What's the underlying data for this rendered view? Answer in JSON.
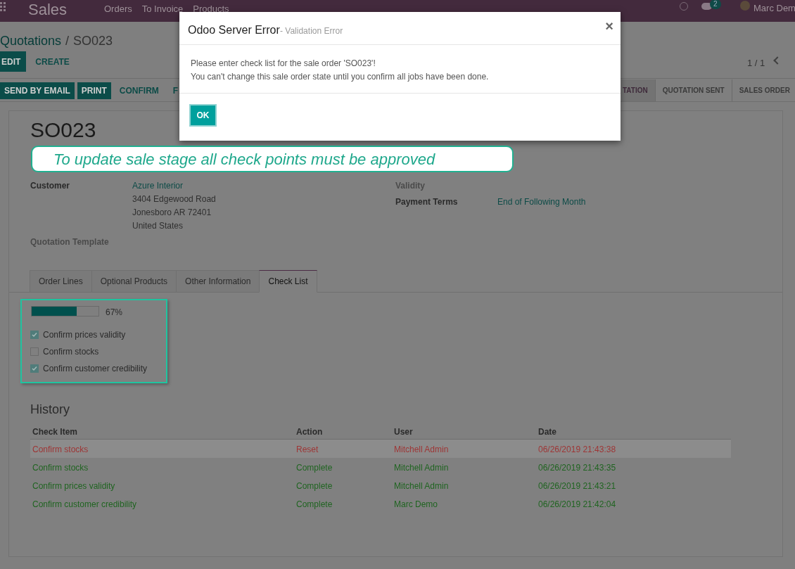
{
  "top_bar": {
    "app": "Sales",
    "menu": [
      "Orders",
      "To Invoice",
      "Products"
    ],
    "message_count": "2",
    "user": "Marc Dem"
  },
  "breadcrumb": {
    "parent": "Quotations",
    "separator": "/",
    "current": "SO023"
  },
  "actions": [
    "EDIT",
    "CREATE"
  ],
  "pager": "1 / 1",
  "header_buttons": [
    {
      "label": "SEND BY EMAIL",
      "primary": true
    },
    {
      "label": "PRINT",
      "primary": true
    },
    {
      "label": "CONFIRM",
      "primary": false
    },
    {
      "label": "F",
      "primary": false
    }
  ],
  "stages": [
    {
      "label": "TATION",
      "selected": true
    },
    {
      "label": "QUOTATION SENT",
      "selected": false
    },
    {
      "label": "SALES ORDER",
      "selected": false
    }
  ],
  "form": {
    "title": "SO023",
    "left_fields": [
      {
        "label": "Customer",
        "link": "Azure Interior",
        "lines": [
          "3404 Edgewood Road",
          "Jonesboro AR 72401",
          "United States"
        ]
      },
      {
        "label": "Quotation Template"
      }
    ],
    "right_fields": [
      {
        "label": "Validity"
      },
      {
        "label": "Payment Terms",
        "link": "End of Following Month"
      }
    ]
  },
  "tabs": [
    {
      "label": "Order Lines",
      "selected": false
    },
    {
      "label": "Optional Products",
      "selected": false
    },
    {
      "label": "Other Information",
      "selected": false
    },
    {
      "label": "Check List",
      "selected": true
    }
  ],
  "checklist": {
    "level": 0.67,
    "reading": "67%",
    "items": [
      {
        "label": "Confirm prices validity",
        "checked": true
      },
      {
        "label": "Confirm stocks",
        "checked": false
      },
      {
        "label": "Confirm customer credibility",
        "checked": true
      }
    ]
  },
  "history": {
    "title": "History",
    "columns": [
      "Check Item",
      "Action",
      "User",
      "Date"
    ],
    "rows": [
      {
        "cells": [
          "Confirm stocks",
          "Reset",
          "Mitchell Admin",
          "06/26/2019 21:43:38"
        ],
        "color": "#9e3535",
        "selected": true
      },
      {
        "cells": [
          "Confirm stocks",
          "Complete",
          "Mitchell Admin",
          "06/26/2019 21:43:35"
        ],
        "color": "#1f6420",
        "selected": false
      },
      {
        "cells": [
          "Confirm prices validity",
          "Complete",
          "Mitchell Admin",
          "06/26/2019 21:43:21"
        ],
        "color": "#1f6420",
        "selected": false
      },
      {
        "cells": [
          "Confirm customer credibility",
          "Complete",
          "Marc Demo",
          "06/26/2019 21:42:04"
        ],
        "color": "#1f6420",
        "selected": false
      }
    ]
  },
  "dialog": {
    "title": "Odoo Server Error",
    "subtitle": "- Validation Error",
    "close": "×",
    "messages": [
      "Please enter check list for the sale order 'SO023'!",
      "You can't change this sale order state until you confirm all jobs have been done."
    ],
    "button": "OK"
  },
  "callout": "To update sale stage all check points must be approved"
}
